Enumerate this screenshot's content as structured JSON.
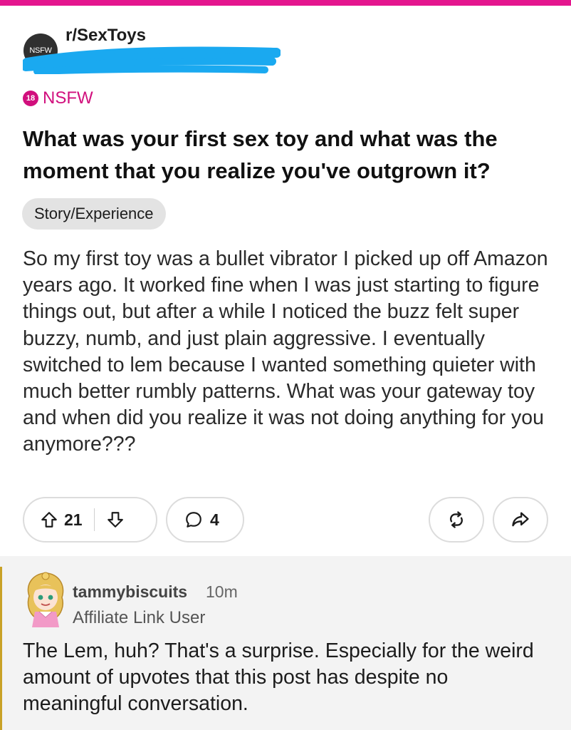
{
  "subreddit": {
    "name": "r/SexToys",
    "avatar_text": "NSFW"
  },
  "post": {
    "nsfw_badge": "18",
    "nsfw_label": "NSFW",
    "title": "What was your first sex toy and what was the moment that you realize you've outgrown it?",
    "flair": "Story/Experience",
    "body": "So my first toy was a bullet vibrator I picked up off Amazon years ago. It worked fine when I was just starting to figure things out, but after a while I noticed the buzz felt super buzzy, numb, and just plain aggressive. I eventually switched to lem because I wanted something quieter with much better rumbly patterns. What was your gateway toy and when did you realize it was not doing anything for you anymore???",
    "upvotes": "21",
    "comments": "4"
  },
  "comment": {
    "username": "tammybiscuits",
    "time": "10m",
    "user_flair": "Affiliate Link User",
    "body": "The Lem, huh? That's a surprise. Especially for the weird amount of upvotes that this post has despite no meaningful conversation."
  },
  "colors": {
    "accent": "#e4168e",
    "nsfw": "#d10f7d",
    "redaction": "#1aa9f0",
    "thread_line": "#c9a227"
  }
}
